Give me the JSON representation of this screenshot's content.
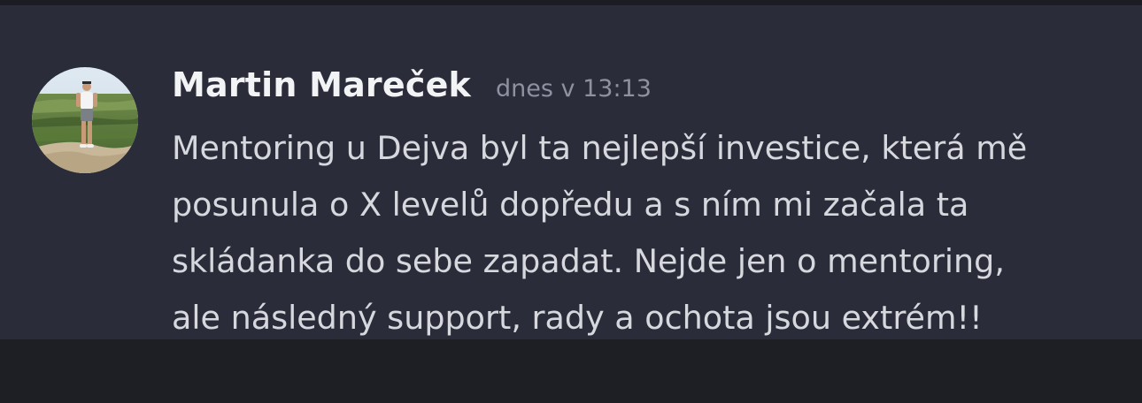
{
  "message": {
    "author": "Martin Mareček",
    "timestamp": "dnes v 13:13",
    "lines": [
      "Mentoring u Dejva byl ta nejlepší investice, která mě",
      "posunula o X levelů dopředu a s ním mi začala ta",
      "skládanka do sebe zapadat. Nejde jen o mentoring,",
      "ale následný support, rady a ochota jsou extrém!!"
    ]
  },
  "colors": {
    "panel_background": "#2a2c3a",
    "page_background": "#1e1f24",
    "author_text": "#f2f3f5",
    "timestamp_text": "#8e91a0",
    "message_text": "#d6d8de"
  }
}
